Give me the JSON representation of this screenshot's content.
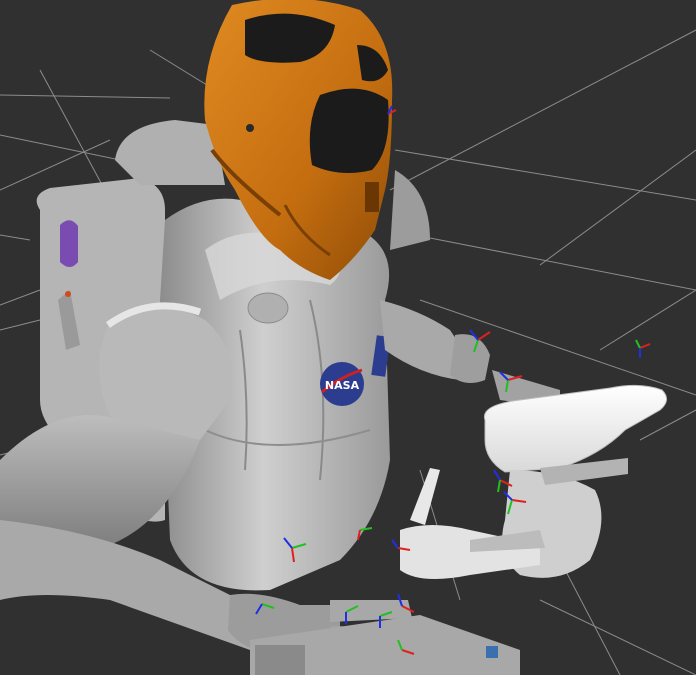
{
  "viewport": {
    "background_color": "#303030",
    "grid_color": "#a0a0a0",
    "robot_body_color": "#c8c8c8",
    "helmet_color": "#c8700f",
    "visor_color": "#1b1b1b",
    "logo_color": "#2c3d8f",
    "ghost_color": "#f4f4f4",
    "axis_colors": {
      "x": "#e02020",
      "y": "#20c020",
      "z": "#2030e0"
    }
  },
  "robot": {
    "chest_logo_text": "NASA",
    "helmet_icon": "robonaut-helmet-icon",
    "backpack_icon": "backpack-icon"
  }
}
